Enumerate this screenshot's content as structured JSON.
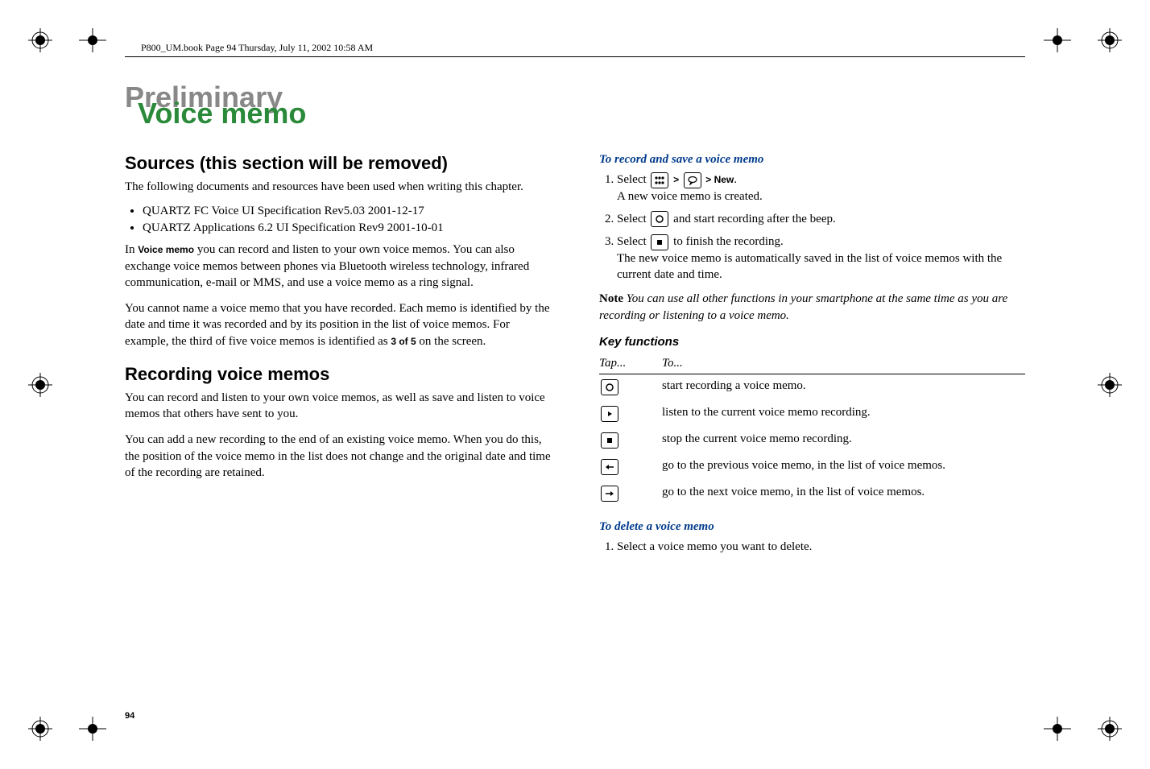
{
  "header": {
    "running": "P800_UM.book  Page 94  Thursday, July 11, 2002  10:58 AM"
  },
  "watermark": "Preliminary",
  "title": "Voice memo",
  "page_number": "94",
  "left": {
    "sources_heading": "Sources (this section will be removed)",
    "sources_intro": "The following documents and resources have been used when writing this chapter.",
    "sources_items": [
      "QUARTZ FC Voice UI Specification Rev5.03 2001-12-17",
      "QUARTZ Applications 6.2 UI Specification Rev9 2001-10-01"
    ],
    "para_voicememo": "In Voice memo you can record and listen to your own voice memos. You can also exchange voice memos between phones via Bluetooth wireless technology, infrared communication, e-mail or MMS, and use a voice memo as a ring signal.",
    "voice_memo_bold": "Voice memo",
    "para_noname": "You cannot name a voice memo that you have recorded. Each memo is identified by the date and time it was recorded and by its position in the list of voice memos. For example, the third of five voice memos is identified as 3 of 5 on the screen.",
    "bold_3of5": "3 of 5",
    "recording_heading": "Recording voice memos",
    "para_recording1": "You can record and listen to your own voice memos, as well as save and listen to voice memos that others have sent to you.",
    "para_recording2": "You can add a new recording to the end of an existing voice memo. When you do this, the position of the voice memo in the list does not change and the original date and time of the recording are retained."
  },
  "right": {
    "to_record_heading": "To record and save a voice memo",
    "step1_a": "Select ",
    "step1_gt": " > ",
    "step1_new": " > New",
    "step1_dot": ".",
    "step1_b": "A new voice memo is created.",
    "step2_a": "Select ",
    "step2_b": " and start recording after the beep.",
    "step3_a": "Select ",
    "step3_b": " to finish the recording.",
    "step3_c": "The new voice memo is automatically saved in the list of voice memos with the current date and time.",
    "note_label": "Note",
    "note_body": " You can use all other functions in your smartphone at the same time as you are recording or listening to a voice memo.",
    "keyfn_heading": "Key functions",
    "table": {
      "head_tap": "Tap...",
      "head_to": "To...",
      "rows": [
        {
          "icon": "record",
          "desc": "start recording a voice memo."
        },
        {
          "icon": "play",
          "desc": "listen to the current voice memo recording."
        },
        {
          "icon": "stop",
          "desc": "stop the current voice memo recording."
        },
        {
          "icon": "prev",
          "desc": "go to the previous voice memo, in the list of voice memos."
        },
        {
          "icon": "next",
          "desc": "go to the next voice memo, in the list of voice memos."
        }
      ]
    },
    "to_delete_heading": "To delete a voice memo",
    "delete_step1": "Select a voice memo you want to delete."
  },
  "icons": {
    "apps": "apps-grid-icon",
    "voice": "voice-bubble-icon",
    "record": "record-circle-icon",
    "play": "play-triangle-icon",
    "stop": "stop-square-icon",
    "prev": "prev-arrow-icon",
    "next": "next-arrow-icon"
  }
}
